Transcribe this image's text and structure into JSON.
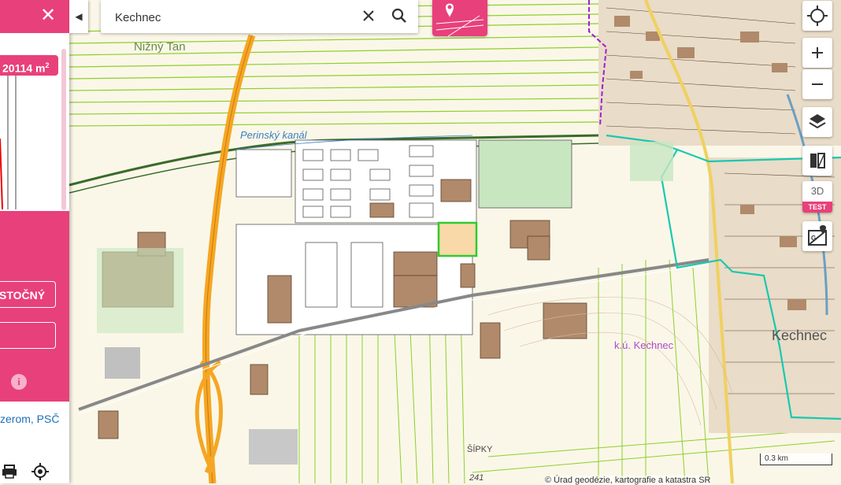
{
  "search": {
    "value": "Kechnec",
    "placeholder": ""
  },
  "panel": {
    "area_value": "20114 m",
    "area_unit_sup": "2",
    "buttons": [
      "STOČNÝ",
      ""
    ],
    "address_link": "zerom, PSČ"
  },
  "map": {
    "labels": {
      "nizny_tan": "Nižný Tan",
      "kanal": "Perinský kanál",
      "ku": "k.ú. Kechnec",
      "town": "Kechnec",
      "sipky": "ŠÍPKY",
      "height": "241"
    },
    "scale": "0.3 km",
    "attribution": "© Úrad geodézie, kartografie a katastra SR"
  },
  "controls": {
    "three_d": "3D",
    "test_tag": "TEST"
  },
  "icons": [
    "close-icon",
    "collapse-icon",
    "clear-icon",
    "search-icon",
    "location-pin-icon",
    "crosshair-icon",
    "plus-icon",
    "minus-icon",
    "layers-icon",
    "compare-icon",
    "map-pin-icon",
    "print-icon",
    "locate-icon",
    "info-icon"
  ],
  "colors": {
    "accent": "#e8407a",
    "parcel_highlight": "#2ecc2e",
    "cadastre_border": "#19c8b0",
    "road": "#f5a623"
  }
}
